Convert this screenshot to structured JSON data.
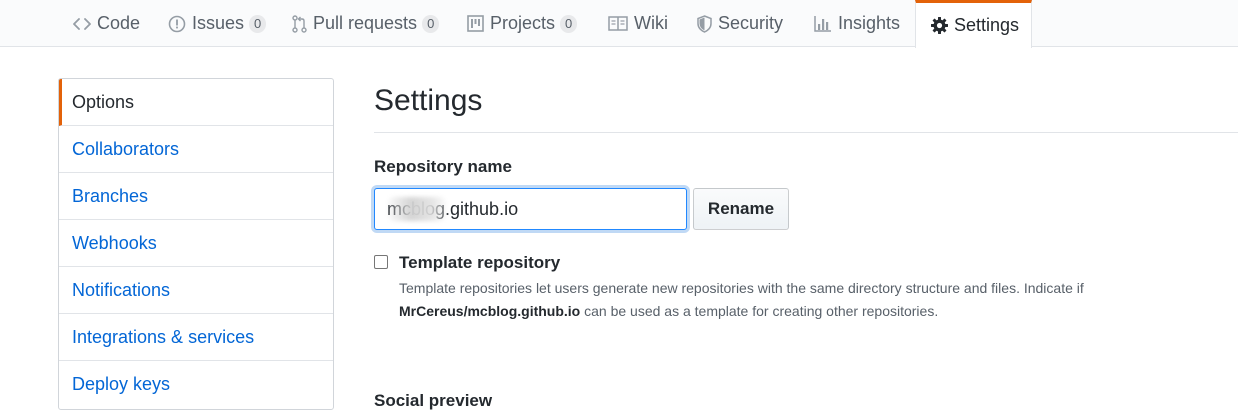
{
  "repo_nav": {
    "tabs": [
      {
        "label": "Code",
        "icon": "code-icon"
      },
      {
        "label": "Issues",
        "icon": "issue-icon",
        "count": "0"
      },
      {
        "label": "Pull requests",
        "icon": "pull-request-icon",
        "count": "0"
      },
      {
        "label": "Projects",
        "icon": "project-icon",
        "count": "0"
      },
      {
        "label": "Wiki",
        "icon": "book-icon"
      },
      {
        "label": "Security",
        "icon": "shield-icon"
      },
      {
        "label": "Insights",
        "icon": "graph-icon"
      },
      {
        "label": "Settings",
        "icon": "gear-icon",
        "selected": true
      }
    ]
  },
  "sidebar": {
    "items": [
      {
        "label": "Options",
        "selected": true
      },
      {
        "label": "Collaborators"
      },
      {
        "label": "Branches"
      },
      {
        "label": "Webhooks"
      },
      {
        "label": "Notifications"
      },
      {
        "label": "Integrations & services"
      },
      {
        "label": "Deploy keys"
      }
    ]
  },
  "main": {
    "title": "Settings",
    "repository_name": {
      "label": "Repository name",
      "value": "mcblog.github.io",
      "visible_suffix": ".github.io",
      "rename_button": "Rename"
    },
    "template_repository": {
      "checked": false,
      "label": "Template repository",
      "description_before": "Template repositories let users generate new repositories with the same directory structure and files. Indicate if",
      "repo_full_name": "MrCereus/mcblog.github.io",
      "description_after": "can be used as a template for creating other repositories."
    },
    "social_preview_heading": "Social preview"
  },
  "colors": {
    "accent": "#e36209",
    "link": "#0366d6",
    "focus": "#2188ff",
    "text": "#24292e",
    "muted": "#586069"
  }
}
